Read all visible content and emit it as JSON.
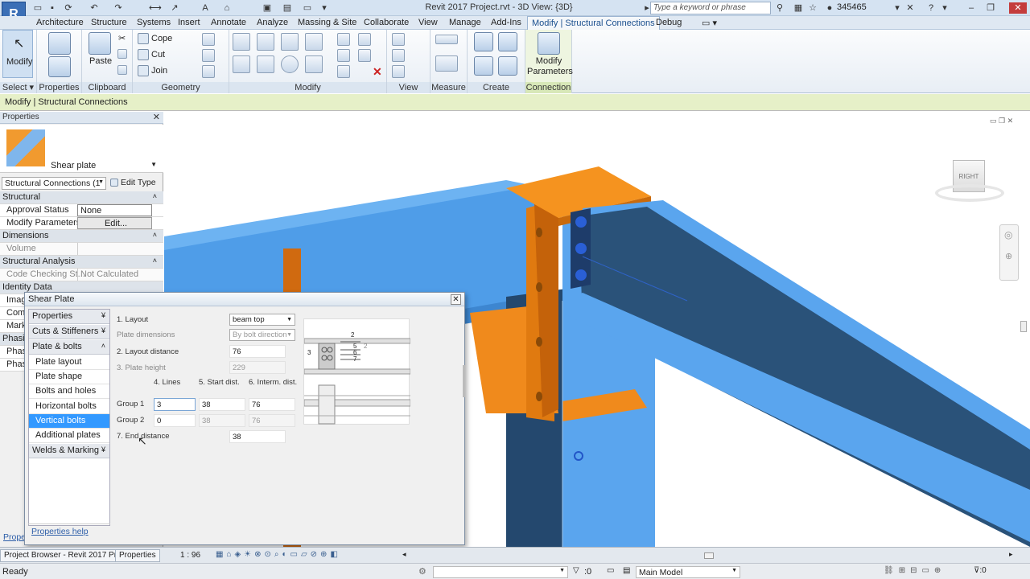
{
  "titlebar": {
    "app_letter": "R",
    "doc_title": "Revit 2017 Project.rvt - 3D View: {3D}",
    "search_placeholder": "Type a keyword or phrase",
    "user": "345465"
  },
  "ribbon_tabs": [
    "Architecture",
    "Structure",
    "Systems",
    "Insert",
    "Annotate",
    "Analyze",
    "Massing & Site",
    "Collaborate",
    "View",
    "Manage",
    "Add-Ins",
    "Modify | Structural Connections",
    "Debug"
  ],
  "ribbon": {
    "select_label": "Modify",
    "panels": {
      "select": "Select",
      "properties": "Properties",
      "clipboard": "Clipboard",
      "geometry": "Geometry",
      "modify": "Modify",
      "view": "View",
      "measure": "Measure",
      "create": "Create",
      "connection": "Connection"
    },
    "paste": "Paste",
    "cope": "Cope",
    "cut": "Cut",
    "join": "Join",
    "modify_parameters": "Modify Parameters"
  },
  "context_bar": "Modify | Structural Connections",
  "properties": {
    "header": "Properties",
    "type_name": "Shear plate",
    "selector": "Structural Connections (1",
    "edit_type": "Edit Type",
    "groups": {
      "structural": "Structural",
      "dimensions": "Dimensions",
      "analysis": "Structural Analysis",
      "identity": "Identity Data"
    },
    "rows": {
      "approval_label": "Approval Status",
      "approval_value": "None",
      "modparams_label": "Modify Parameters",
      "modparams_value": "Edit...",
      "volume_label": "Volume",
      "codecheck_label": "Code Checking St...",
      "codecheck_value": "Not Calculated"
    },
    "partial_labels": [
      "Imag",
      "Com",
      "Mark",
      "Phasi",
      "Phas",
      "Phas"
    ],
    "help_fragment": "Prope"
  },
  "dialog": {
    "title": "Shear Plate",
    "nav": {
      "properties": "Properties",
      "cuts": "Cuts & Stiffeners",
      "plate_bolts": "Plate & bolts",
      "items": [
        "Plate layout",
        "Plate shape",
        "Bolts and holes",
        "Horizontal bolts",
        "Vertical bolts",
        "Additional plates"
      ],
      "welds": "Welds & Marking"
    },
    "fields": {
      "layout_label": "1. Layout",
      "layout_value": "beam top",
      "plate_dim_label": "Plate dimensions",
      "plate_dim_value": "By bolt direction",
      "layout_dist_label": "2. Layout distance",
      "layout_dist_value": "76",
      "plate_height_label": "3. Plate height",
      "plate_height_value": "229",
      "col_lines": "4. Lines",
      "col_start": "5. Start dist.",
      "col_interm": "6. Interm. dist.",
      "group1_label": "Group 1",
      "group1_lines": "3",
      "group1_start": "38",
      "group1_interm": "76",
      "group2_label": "Group 2",
      "group2_lines": "0",
      "group2_start": "38",
      "group2_interm": "76",
      "end_dist_label": "7. End distance",
      "end_dist_value": "38"
    },
    "diagram_labels": [
      "2",
      "5",
      "6",
      "7",
      "3",
      "2"
    ],
    "help_link": "Properties help"
  },
  "statusbar": {
    "project_browser": "Project Browser - Revit 2017 Pr...",
    "properties_tab": "Properties",
    "scale": "1 : 96"
  },
  "bottombar": {
    "status": "Ready",
    "select_count": ":0",
    "model": "Main Model"
  },
  "viewcube": {
    "face": "RIGHT"
  },
  "colors": {
    "beam_blue": "#4f9de8",
    "beam_dark": "#24486e",
    "plate_orange": "#f08a1c",
    "nav_selected": "#3399ff"
  }
}
